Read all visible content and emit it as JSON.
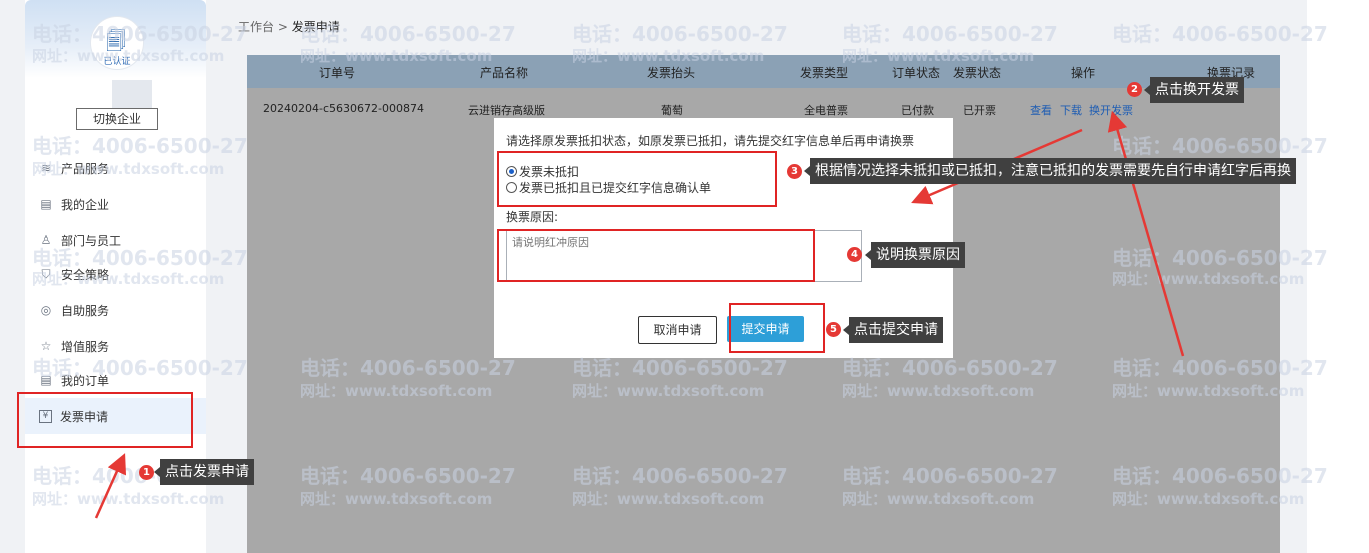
{
  "breadcrumb": {
    "home": "工作台",
    "sep": " > ",
    "current": "发票申请"
  },
  "sidebar": {
    "verified_label": "已认证",
    "switch_label": "切换企业",
    "items": [
      {
        "label": "产品服务",
        "icon": "layers-icon"
      },
      {
        "label": "我的企业",
        "icon": "document-icon"
      },
      {
        "label": "部门与员工",
        "icon": "users-icon"
      },
      {
        "label": "安全策略",
        "icon": "shield-icon"
      },
      {
        "label": "自助服务",
        "icon": "target-icon"
      },
      {
        "label": "增值服务",
        "icon": "star-icon"
      },
      {
        "label": "我的订单",
        "icon": "list-icon"
      },
      {
        "label": "发票申请",
        "icon": "yen-icon"
      }
    ]
  },
  "table": {
    "headers": [
      "订单号",
      "产品名称",
      "发票抬头",
      "发票类型",
      "订单状态",
      "发票状态",
      "操作",
      "换票记录"
    ],
    "row": {
      "order_no": "20240204-c5630672-000874",
      "product": "云进销存高级版",
      "title": "葡萄",
      "type": "全电普票",
      "order_status": "已付款",
      "invoice_status": "已开票",
      "actions": [
        "查看",
        "下载",
        "换开发票"
      ]
    }
  },
  "modal": {
    "title": "请选择原发票抵扣状态，如原发票已抵扣，请先提交红字信息单后再申请换票",
    "option1": "发票未抵扣",
    "option2": "发票已抵扣且已提交红字信息确认单",
    "reason_label": "换票原因:",
    "reason_placeholder": "请说明红冲原因",
    "cancel_label": "取消申请",
    "submit_label": "提交申请"
  },
  "annotations": [
    {
      "num": "1",
      "text": "点击发票申请"
    },
    {
      "num": "2",
      "text": "点击换开发票"
    },
    {
      "num": "3",
      "text": "根据情况选择未抵扣或已抵扣，注意已抵扣的发票需要先自行申请红字后再换"
    },
    {
      "num": "4",
      "text": "说明换票原因"
    },
    {
      "num": "5",
      "text": "点击提交申请"
    }
  ],
  "watermark": {
    "phone": "电话：4006-6500-27",
    "site": "网址：www.tdxsoft.com"
  },
  "colors": {
    "accent": "#2d9fd8",
    "annotation": "#e02424",
    "tooltip": "#404040",
    "link": "#1e5db3"
  }
}
